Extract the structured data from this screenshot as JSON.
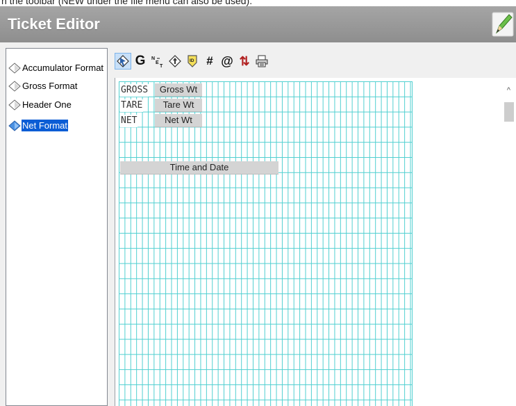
{
  "doc_snippet": "n the toolbar (NEW under the file menu can also be used).",
  "window": {
    "title": "Ticket Editor"
  },
  "tree": {
    "items": [
      {
        "label": "Accumulator Format",
        "selected": false
      },
      {
        "label": "Gross Format",
        "selected": false
      },
      {
        "label": "Header One",
        "selected": false
      },
      {
        "label": "Net Format",
        "selected": true
      }
    ]
  },
  "toolbar": {
    "buttons": [
      {
        "icon": "select-pointer-icon",
        "active": true
      },
      {
        "icon": "gross-g-icon",
        "glyph": "G"
      },
      {
        "icon": "net-tare-icon",
        "glyph": "NE T"
      },
      {
        "icon": "diamond-arrow-icon"
      },
      {
        "icon": "id-badge-icon",
        "glyph": "ID"
      },
      {
        "icon": "number-hash-icon",
        "glyph": "#"
      },
      {
        "icon": "at-sign-icon",
        "glyph": "@"
      },
      {
        "icon": "swap-arrows-icon",
        "glyph": "⇅"
      },
      {
        "icon": "printer-icon"
      }
    ]
  },
  "ticket": {
    "rows": [
      {
        "label": "GROSS",
        "field": "Gross Wt"
      },
      {
        "label": "TARE",
        "field": "Tare Wt"
      },
      {
        "label": "NET",
        "field": "Net Wt"
      }
    ],
    "time_field": "Time and Date"
  },
  "colors": {
    "grid_line": "#4fcfd0",
    "selection": "#0b5dd5",
    "title_bar": "#9a9a9a",
    "field_bg": "#d4d4d4"
  }
}
